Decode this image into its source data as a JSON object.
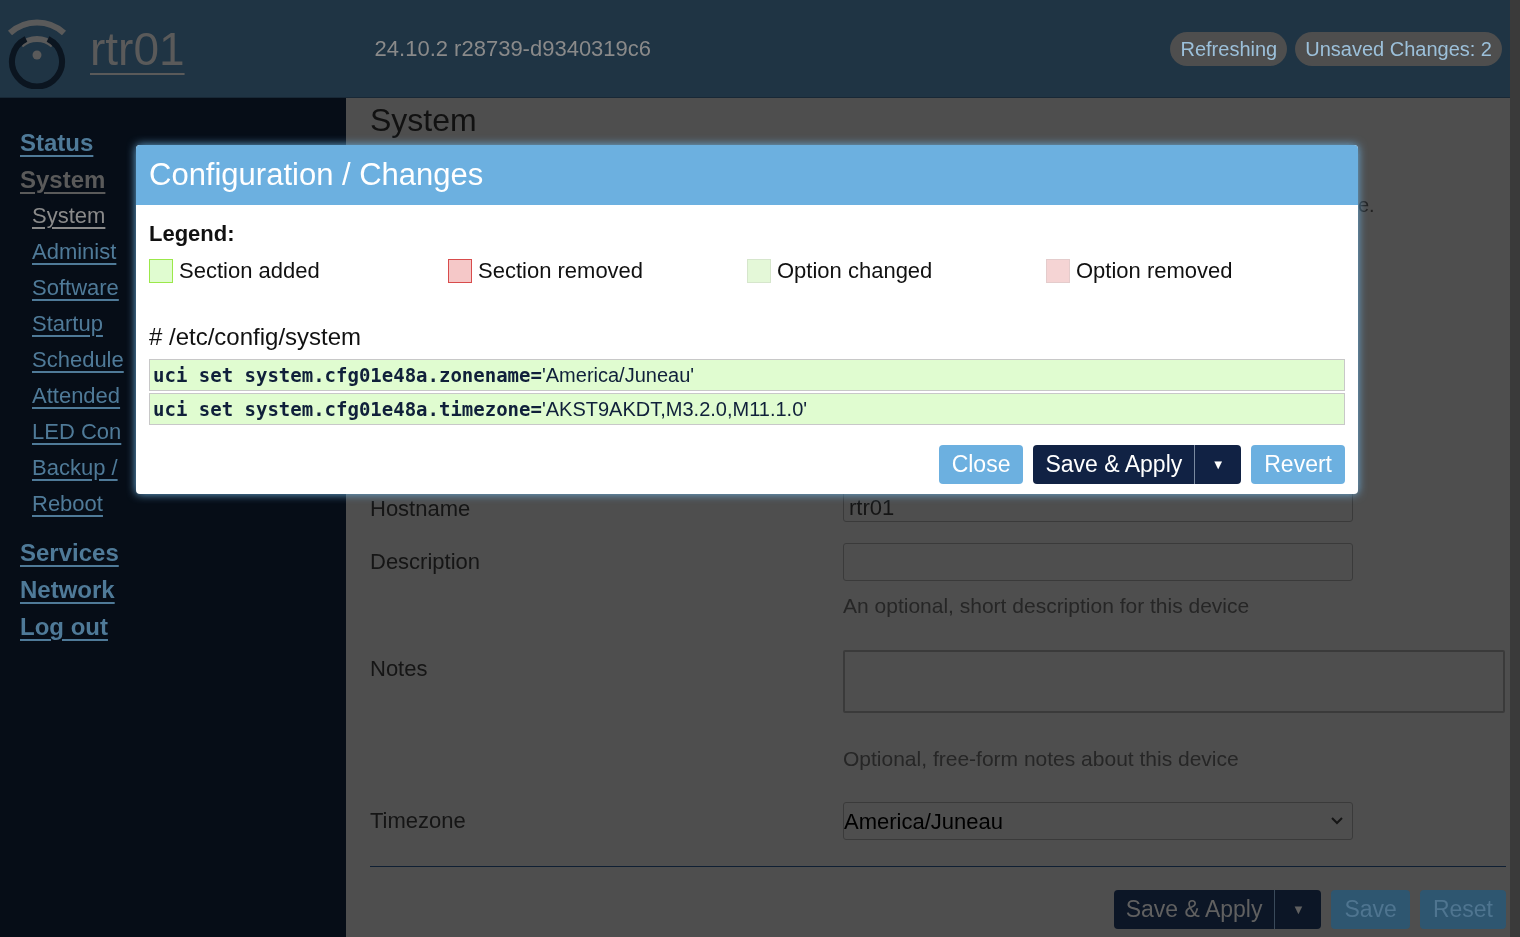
{
  "header": {
    "hostname": "rtr01",
    "version": "24.10.2 r28739-d9340319c6",
    "badges": [
      "Refreshing",
      "Unsaved Changes: 2"
    ]
  },
  "sidebar": {
    "items": [
      {
        "label": "Status",
        "selected": false
      },
      {
        "label": "System",
        "selected": true,
        "children": [
          {
            "label": "System",
            "selected": true
          },
          {
            "label": "Administ",
            "selected": false
          },
          {
            "label": "Software",
            "selected": false
          },
          {
            "label": "Startup",
            "selected": false
          },
          {
            "label": "Schedule",
            "selected": false
          },
          {
            "label": "Attended",
            "selected": false
          },
          {
            "label": "LED Con",
            "selected": false
          },
          {
            "label": "Backup /",
            "selected": false
          },
          {
            "label": "Reboot",
            "selected": false
          }
        ]
      },
      {
        "label": "Services",
        "selected": false
      },
      {
        "label": "Network",
        "selected": false
      },
      {
        "label": "Log out",
        "selected": false
      }
    ]
  },
  "page": {
    "title": "System",
    "text_fragment": "e.",
    "fields": [
      {
        "kind": "text",
        "label": "Hostname",
        "value": "rtr01"
      },
      {
        "kind": "text",
        "label": "Description",
        "help": "An optional, short description for this device"
      },
      {
        "kind": "textarea",
        "label": "Notes",
        "help": "Optional, free-form notes about this device"
      },
      {
        "kind": "select",
        "label": "Timezone",
        "value": "America/Juneau"
      }
    ],
    "buttons": [
      {
        "kind": "split",
        "label": "Save & Apply",
        "caret": "▼"
      },
      {
        "kind": "plain",
        "label": "Save"
      },
      {
        "kind": "plain",
        "label": "Reset"
      }
    ]
  },
  "modal": {
    "title": "Configuration / Changes",
    "legend_title": "Legend:",
    "legend": [
      {
        "kind": "section-added",
        "label": "Section added"
      },
      {
        "kind": "section-removed",
        "label": "Section removed"
      },
      {
        "kind": "option-changed",
        "label": "Option changed"
      },
      {
        "kind": "option-removed",
        "label": "Option removed"
      }
    ],
    "file": "# /etc/config/system",
    "changes": [
      {
        "command": "uci set system.cfg01e48a.zonename=",
        "value": "'America/Juneau'"
      },
      {
        "command": "uci set system.cfg01e48a.timezone=",
        "value": "'AKST9AKDT,M3.2.0,M11.1.0'"
      }
    ],
    "buttons": [
      {
        "kind": "light",
        "label": "Close"
      },
      {
        "kind": "split",
        "label": "Save & Apply",
        "caret": "▼"
      },
      {
        "kind": "light",
        "label": "Revert"
      }
    ]
  }
}
